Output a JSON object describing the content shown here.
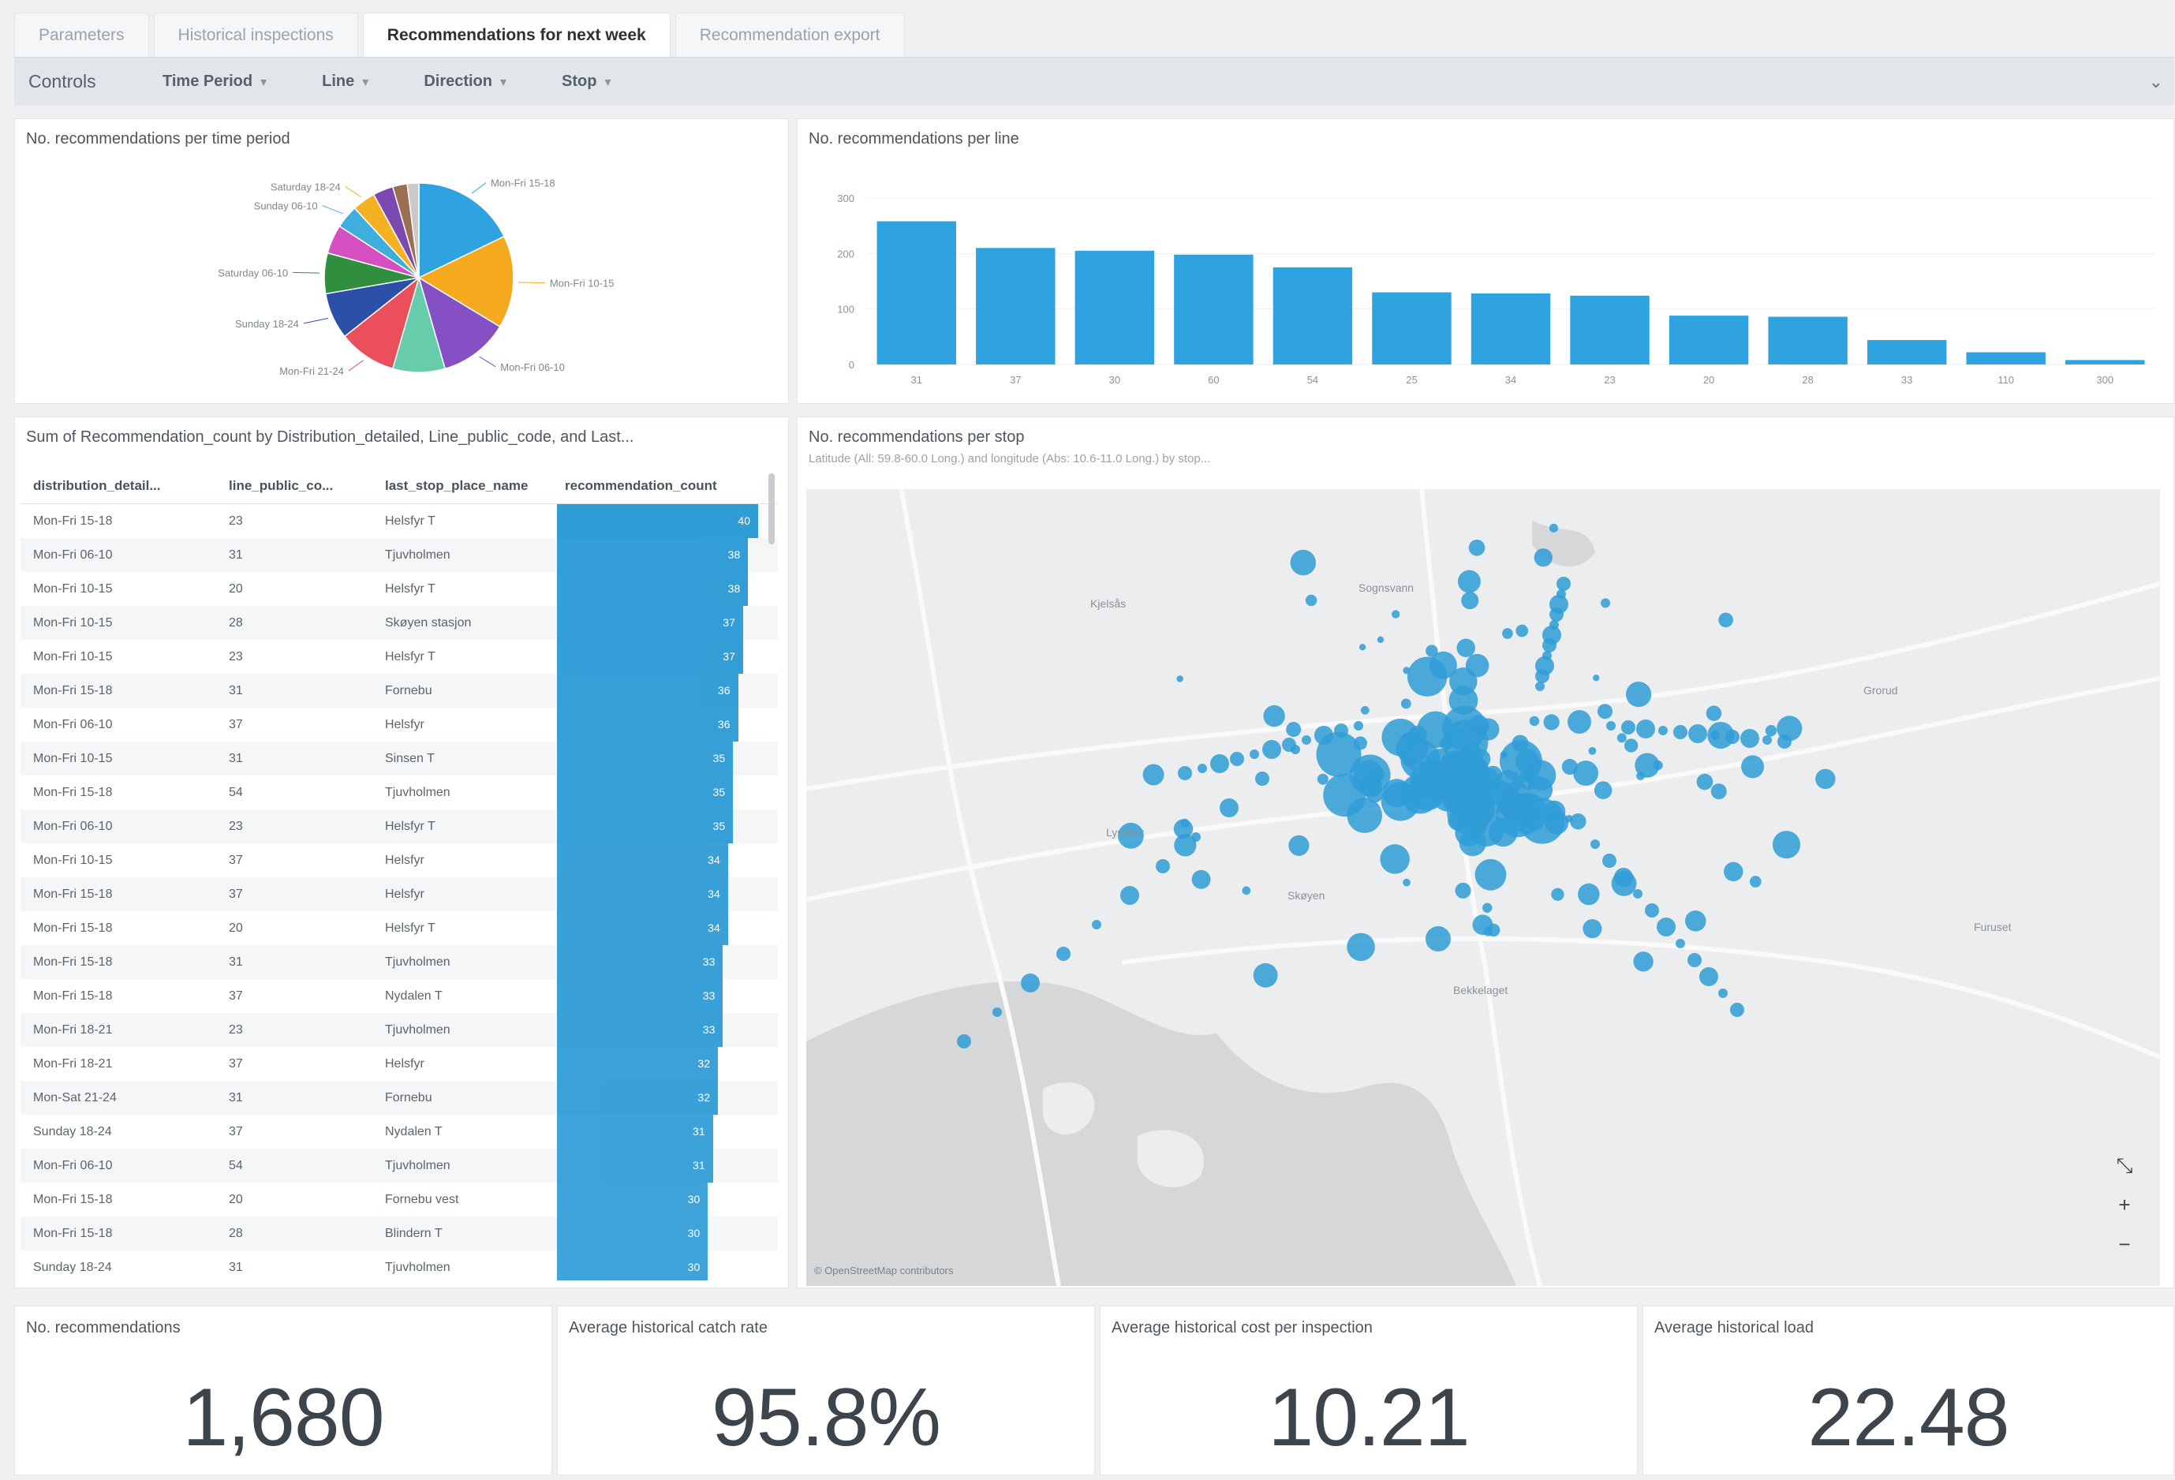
{
  "tabs": [
    {
      "label": "Parameters",
      "active": false
    },
    {
      "label": "Historical inspections",
      "active": false
    },
    {
      "label": "Recommendations for next week",
      "active": true
    },
    {
      "label": "Recommendation export",
      "active": false
    }
  ],
  "controls": {
    "title": "Controls",
    "filters": [
      "Time Period",
      "Line",
      "Direction",
      "Stop"
    ]
  },
  "pie_panel": {
    "title": "No. recommendations per time period",
    "chart_data": {
      "type": "pie",
      "slices": [
        {
          "label": "Mon-Fri 15-18",
          "value": 0.18,
          "color": "#2fa3df"
        },
        {
          "label": "Mon-Fri 10-15",
          "value": 0.16,
          "color": "#f5a91e"
        },
        {
          "label": "Mon-Fri 06-10",
          "value": 0.12,
          "color": "#8450c4"
        },
        {
          "label": "",
          "value": 0.09,
          "color": "#66ccab"
        },
        {
          "label": "Mon-Fri 21-24",
          "value": 0.1,
          "color": "#ec4f5c"
        },
        {
          "label": "Sunday 18-24",
          "value": 0.08,
          "color": "#2c4fa8"
        },
        {
          "label": "Saturday 06-10",
          "value": 0.07,
          "color": "#2f8f3e"
        },
        {
          "label": "",
          "value": 0.05,
          "color": "#d64fc0"
        },
        {
          "label": "Sunday 06-10",
          "value": 0.04,
          "color": "#3eaedc"
        },
        {
          "label": "Saturday 18-24",
          "value": 0.04,
          "color": "#f4b223"
        },
        {
          "label": "",
          "value": 0.035,
          "color": "#7a4ab0"
        },
        {
          "label": "",
          "value": 0.025,
          "color": "#9b6f52"
        },
        {
          "label": "",
          "value": 0.02,
          "color": "#c9c9c9"
        }
      ]
    }
  },
  "bar_panel": {
    "title": "No. recommendations per line",
    "chart_data": {
      "type": "bar",
      "categories": [
        "31",
        "37",
        "30",
        "60",
        "54",
        "25",
        "34",
        "23",
        "20",
        "28",
        "33",
        "110",
        "300"
      ],
      "values": [
        258,
        210,
        205,
        198,
        175,
        130,
        128,
        124,
        88,
        86,
        44,
        22,
        8
      ],
      "ylim": [
        0,
        300
      ],
      "yticks": [
        0,
        100,
        200,
        300
      ],
      "color": "#2fa3df"
    }
  },
  "table_panel": {
    "title": "Sum of Recommendation_count by Distribution_detailed, Line_public_code, and Last...",
    "columns": [
      "distribution_detail...",
      "line_public_co...",
      "last_stop_place_name",
      "recommendation_count"
    ],
    "rows": [
      [
        "Mon-Fri 15-18",
        "23",
        "Helsfyr T",
        "40"
      ],
      [
        "Mon-Fri 06-10",
        "31",
        "Tjuvholmen",
        "38"
      ],
      [
        "Mon-Fri 10-15",
        "20",
        "Helsfyr T",
        "38"
      ],
      [
        "Mon-Fri 10-15",
        "28",
        "Skøyen stasjon",
        "37"
      ],
      [
        "Mon-Fri 10-15",
        "23",
        "Helsfyr T",
        "37"
      ],
      [
        "Mon-Fri 15-18",
        "31",
        "Fornebu",
        "36"
      ],
      [
        "Mon-Fri 06-10",
        "37",
        "Helsfyr",
        "36"
      ],
      [
        "Mon-Fri 10-15",
        "31",
        "Sinsen T",
        "35"
      ],
      [
        "Mon-Fri 15-18",
        "54",
        "Tjuvholmen",
        "35"
      ],
      [
        "Mon-Fri 06-10",
        "23",
        "Helsfyr T",
        "35"
      ],
      [
        "Mon-Fri 10-15",
        "37",
        "Helsfyr",
        "34"
      ],
      [
        "Mon-Fri 15-18",
        "37",
        "Helsfyr",
        "34"
      ],
      [
        "Mon-Fri 15-18",
        "20",
        "Helsfyr T",
        "34"
      ],
      [
        "Mon-Fri 15-18",
        "31",
        "Tjuvholmen",
        "33"
      ],
      [
        "Mon-Fri 15-18",
        "37",
        "Nydalen T",
        "33"
      ],
      [
        "Mon-Fri 18-21",
        "23",
        "Tjuvholmen",
        "33"
      ],
      [
        "Mon-Fri 18-21",
        "37",
        "Helsfyr",
        "32"
      ],
      [
        "Mon-Sat 21-24",
        "31",
        "Fornebu",
        "32"
      ],
      [
        "Sunday 18-24",
        "37",
        "Nydalen T",
        "31"
      ],
      [
        "Mon-Fri 06-10",
        "54",
        "Tjuvholmen",
        "31"
      ],
      [
        "Mon-Fri 15-18",
        "20",
        "Fornebu vest",
        "30"
      ],
      [
        "Mon-Fri 15-18",
        "28",
        "Blindern T",
        "30"
      ],
      [
        "Sunday 18-24",
        "31",
        "Tjuvholmen",
        "30"
      ]
    ]
  },
  "map_panel": {
    "title": "No. recommendations per stop",
    "subtitle": "Latitude (All: 59.8-60.0 Long.) and longitude (Abs: 10.6-11.0 Long.) by stop...",
    "place_labels": [
      "Sognsvann",
      "Skøyen",
      "Lysaker",
      "Kjelsås",
      "Grorud",
      "Furuset",
      "Bekkelaget"
    ],
    "attribution": "© OpenStreetMap contributors",
    "controls": [
      "collapse",
      "+",
      "−"
    ]
  },
  "kpis": [
    {
      "title": "No. recommendations",
      "value": "1,680"
    },
    {
      "title": "Average historical catch rate",
      "value": "95.8%"
    },
    {
      "title": "Average historical cost per inspection",
      "value": "10.21"
    },
    {
      "title": "Average historical load",
      "value": "22.48"
    }
  ]
}
